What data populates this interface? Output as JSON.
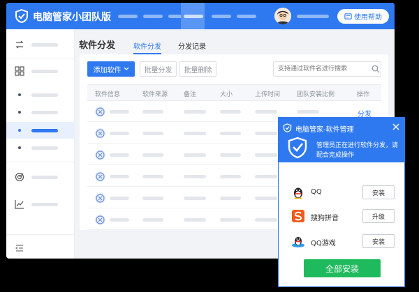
{
  "app": {
    "title": "电脑管家小团队版",
    "help_label": "使用帮助"
  },
  "content": {
    "title": "软件分发",
    "tabs": [
      {
        "label": "软件分发",
        "active": true
      },
      {
        "label": "分发记录",
        "active": false
      }
    ],
    "toolbar": {
      "add_label": "添加软件",
      "batch_dist_label": "批量分发",
      "batch_delete_label": "批量删除",
      "search_placeholder": "支持通过软件名进行搜索"
    },
    "table": {
      "columns": [
        "软件信息",
        "软件来源",
        "备注",
        "大小",
        "上传时间",
        "团队安装比例",
        "操作"
      ],
      "first_row_action": "分发"
    }
  },
  "popup": {
    "title": "电脑管家-软件管理",
    "message": "管理员正在进行软件分发，请配合完成操作",
    "apps": [
      {
        "name": "QQ",
        "action": "安装",
        "icon": "penguin-icon"
      },
      {
        "name": "搜狗拼音",
        "action": "升级",
        "icon": "sogou-icon"
      },
      {
        "name": "QQ游戏",
        "action": "安装",
        "icon": "qq-game-icon"
      }
    ],
    "install_all_label": "全部安装"
  },
  "colors": {
    "primary": "#2f79f0",
    "success": "#1fba5d",
    "sidebar_selected": "#e8f0fe"
  }
}
